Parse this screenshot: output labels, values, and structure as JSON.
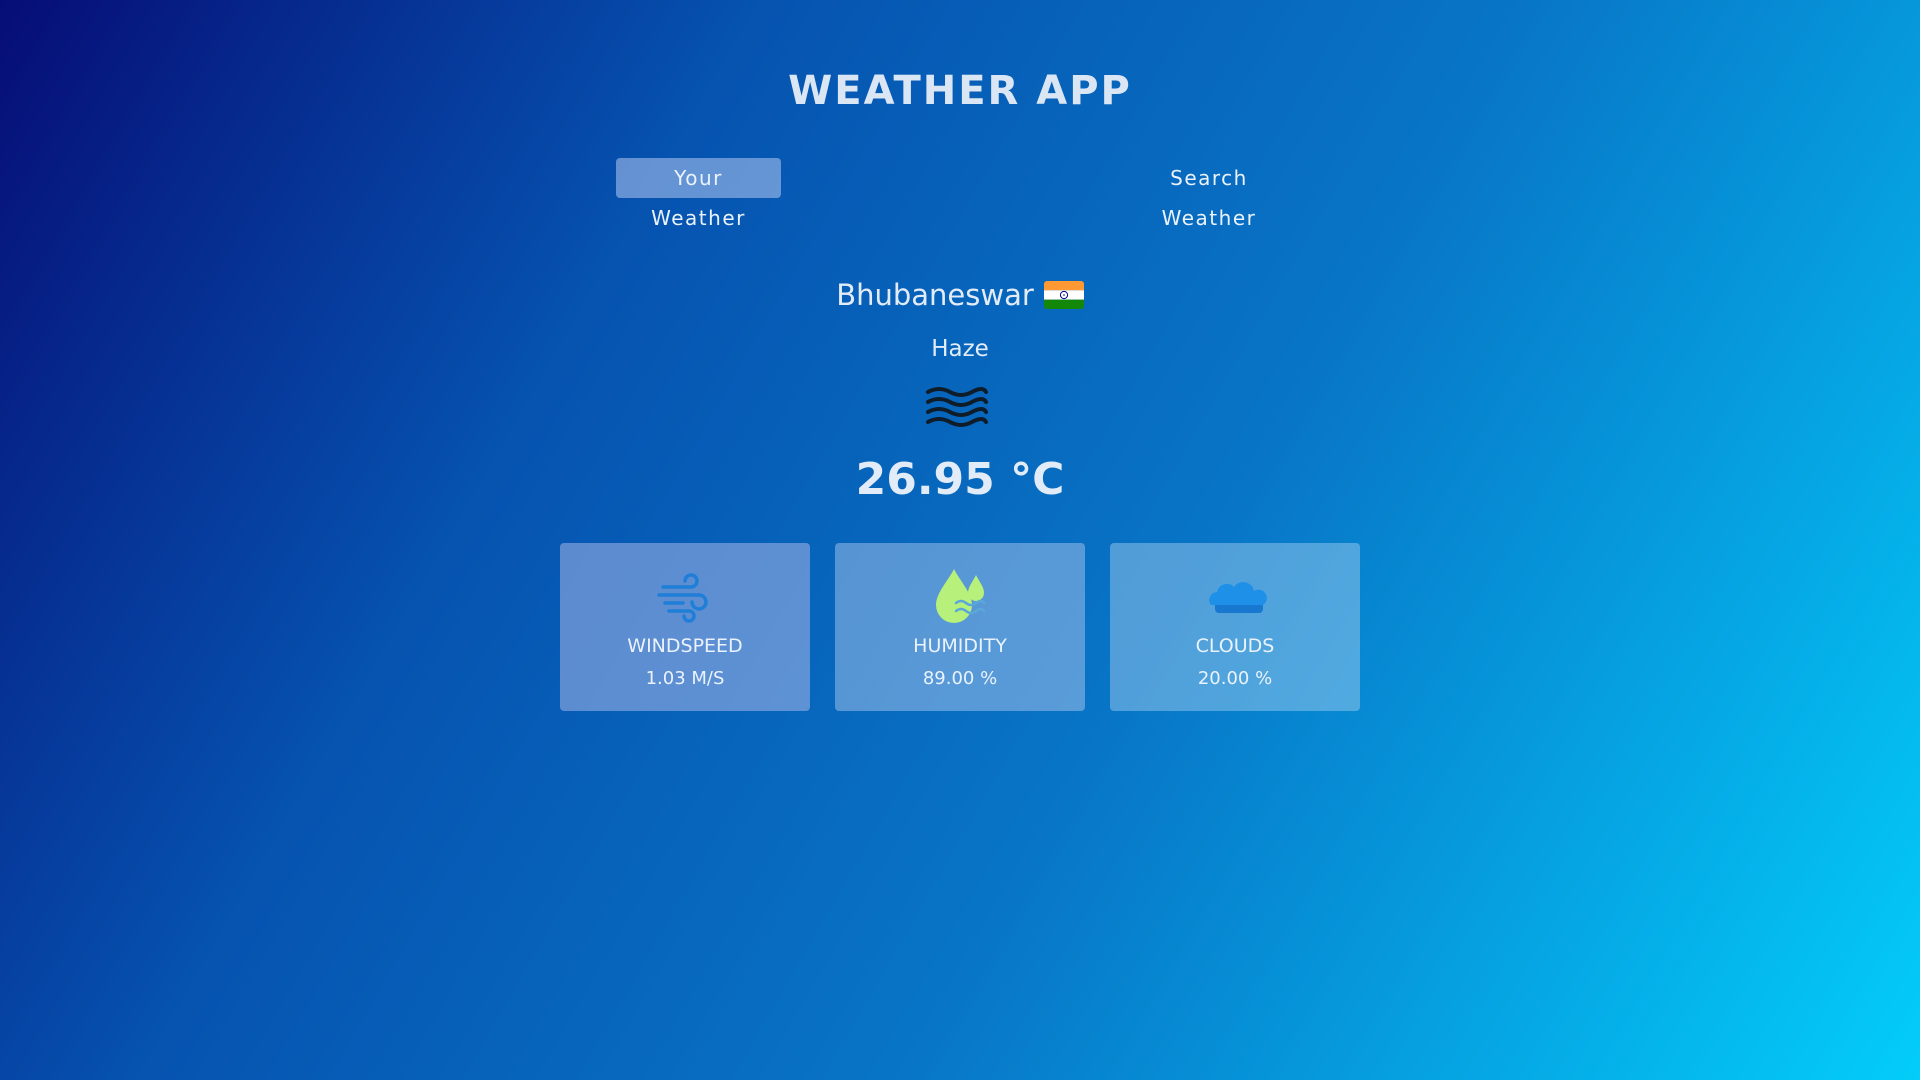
{
  "app": {
    "title": "WEATHER APP"
  },
  "tabs": [
    {
      "label": "Your Weather",
      "active": true
    },
    {
      "label": "Search Weather",
      "active": false
    }
  ],
  "weather": {
    "city": "Bhubaneswar",
    "country_flag_icon": "india-flag-icon",
    "condition": "Haze",
    "condition_icon": "haze-icon",
    "temperature": "26.95 °C"
  },
  "stats": [
    {
      "label": "WINDSPEED",
      "value": "1.03 M/S",
      "icon": "wind-icon",
      "icon_color": "#1f7fd8"
    },
    {
      "label": "HUMIDITY",
      "value": "89.00 %",
      "icon": "humidity-icon",
      "icon_color": "#b7f07a"
    },
    {
      "label": "CLOUDS",
      "value": "20.00 %",
      "icon": "cloud-icon",
      "icon_color": "#1e90e8"
    }
  ],
  "colors": {
    "background_start": "#060d76",
    "background_end": "#03cdfa",
    "text": "#e2ecf8"
  }
}
